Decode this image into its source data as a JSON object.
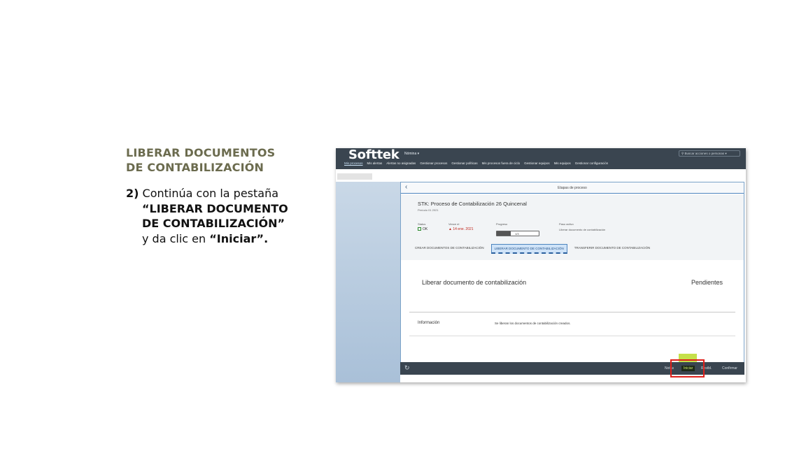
{
  "instruction": {
    "title_line1": "LIBERAR DOCUMENTOS",
    "title_line2": "DE CONTABILIZACIÓN",
    "step": "2)",
    "text1": " Continúa con la pestaña",
    "tab_name_line1": "“LIBERAR DOCUMENTO",
    "tab_name_line2": "DE CONTABILIZACIÓN”",
    "text2": "y da clic en ",
    "action": "“Iniciar”."
  },
  "app": {
    "logo": "Softtek",
    "menu": "Nómina ▾",
    "search_placeholder": "Buscar acciones o personas ▾",
    "nav": [
      "Mis procesos",
      "Mis alertas",
      "Alertas no asignadas",
      "Gestionar procesos",
      "Gestionar políticas",
      "Mis procesos fuera de ciclo",
      "Gestionar equipos",
      "Mis equipos",
      "Gestionar configuración"
    ]
  },
  "dialog": {
    "title": "Etapas de proceso",
    "process_title": "STK: Proceso de Contabilización 26 Quincenal",
    "period": "Período 01 2021",
    "status_label": "Status",
    "status_value": "OK",
    "due_label": "Vence el",
    "due_value": "14 ene. 2021",
    "progress_label": "Progreso",
    "progress_value": 0.33,
    "progress_text": "1/3",
    "next_label": "Paso activo",
    "next_value": "Liberar documento de contabilización",
    "tabs": [
      "CREAR DOCUMENTOS DE CONTABILIZACIÓN",
      "LIBERAR DOCUMENTO DE CONTABILIZACIÓN",
      "TRANSFERIR DOCUMENTO DE CONTABILIZACIÓN"
    ],
    "section_title": "Liberar documento de contabilización",
    "pending": "Pendientes",
    "info_label": "Información",
    "info_value": "Se liberan los documentos de contabilización creados."
  },
  "footer": {
    "notes": "Notas",
    "start": "Iniciar",
    "reset": "Restbl.",
    "confirm": "Confirmar"
  },
  "colors": {
    "highlight": "#e0201b",
    "topbar": "#3a4550",
    "title_olive": "#6b6b4e"
  }
}
